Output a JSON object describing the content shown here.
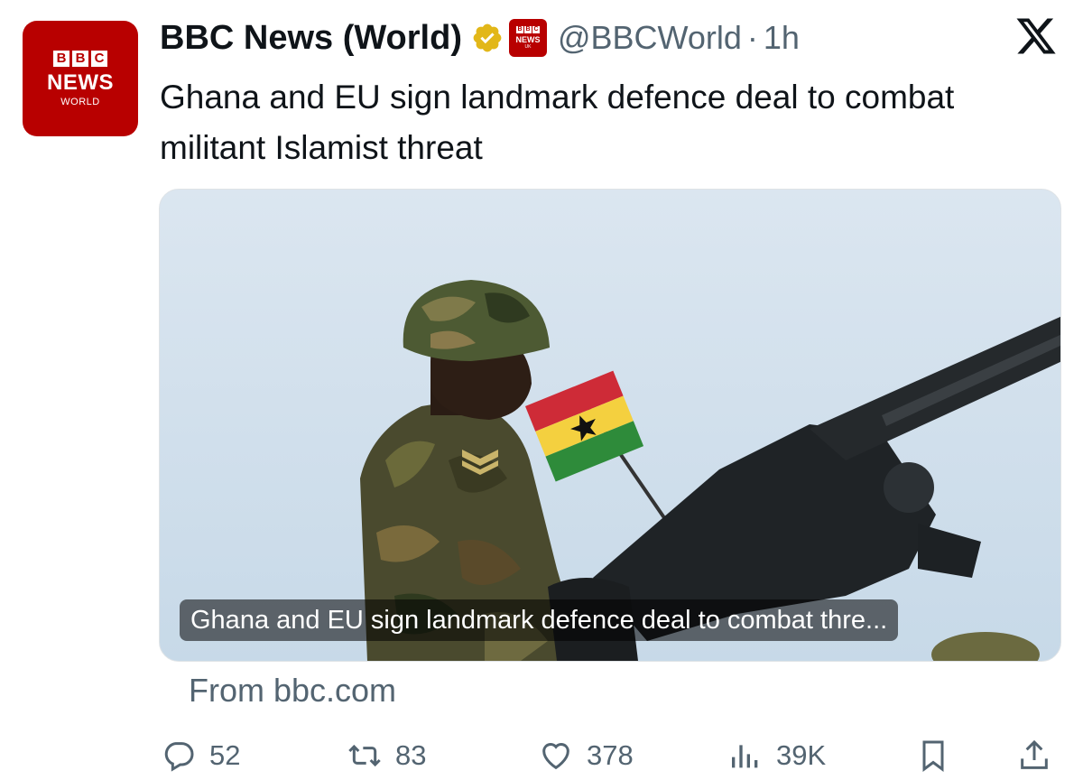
{
  "author": {
    "display_name": "BBC News (World)",
    "handle": "@BBCWorld",
    "separator": "·",
    "time": "1h",
    "avatar": {
      "letters": [
        "B",
        "B",
        "C"
      ],
      "line1": "NEWS",
      "line2": "WORLD"
    }
  },
  "tweet": {
    "text": "Ghana and EU sign landmark defence deal to combat militant Islamist threat"
  },
  "card": {
    "caption": "Ghana and EU sign landmark defence deal to combat thre...",
    "source": "From bbc.com"
  },
  "actions": {
    "replies": "52",
    "reposts": "83",
    "likes": "378",
    "views": "39K"
  },
  "colors": {
    "bbc_red": "#b80000",
    "muted": "#536471",
    "verified_gold": "#e2b719"
  },
  "icons": [
    "x-logo-icon",
    "verified-badge-icon",
    "reply-icon",
    "repost-icon",
    "like-icon",
    "views-icon",
    "bookmark-icon",
    "share-icon"
  ]
}
